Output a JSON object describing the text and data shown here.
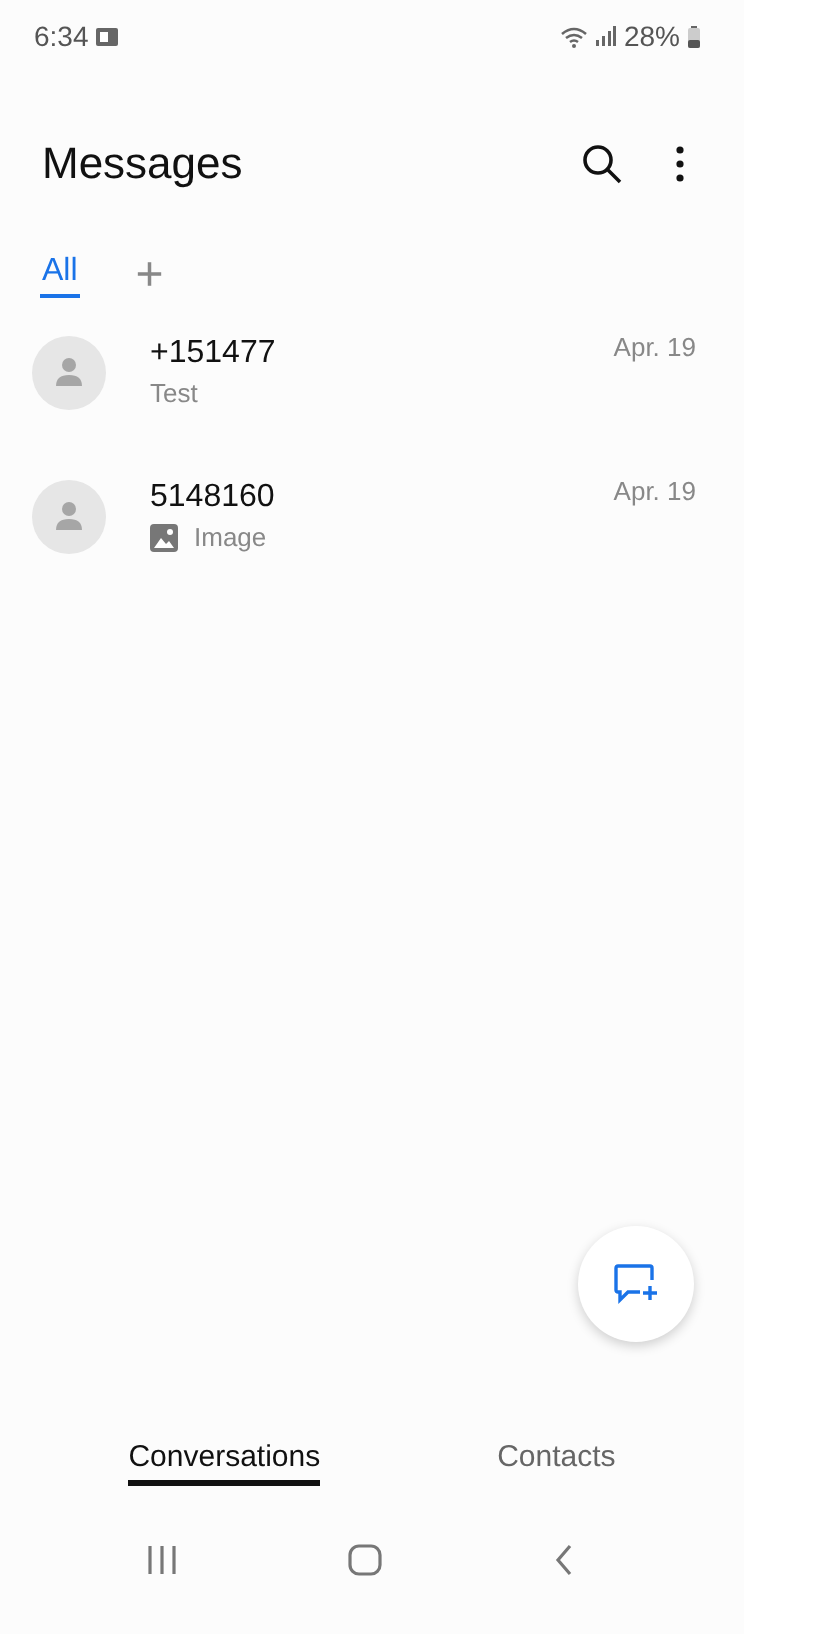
{
  "status_bar": {
    "time": "6:34",
    "battery": "28%"
  },
  "header": {
    "title": "Messages"
  },
  "filter_tabs": [
    {
      "label": "All",
      "selected": true
    }
  ],
  "add_tab": "+",
  "conversations": [
    {
      "name": "+151477",
      "preview": "Test",
      "date": "Apr. 19",
      "kind": "text"
    },
    {
      "name": "5148160",
      "preview": "Image",
      "date": "Apr. 19",
      "kind": "image"
    }
  ],
  "bottom_tabs": [
    {
      "label": "Conversations",
      "selected": true
    },
    {
      "label": "Contacts",
      "selected": false
    }
  ]
}
